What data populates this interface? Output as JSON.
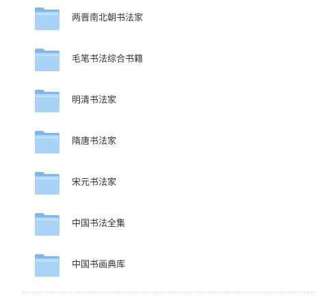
{
  "folders": [
    {
      "name": "两晋南北朝书法家",
      "icon": "folder-icon"
    },
    {
      "name": "毛笔书法综合书籍",
      "icon": "folder-icon"
    },
    {
      "name": "明清书法家",
      "icon": "folder-icon"
    },
    {
      "name": "隋唐书法家",
      "icon": "folder-icon"
    },
    {
      "name": "宋元书法家",
      "icon": "folder-icon"
    },
    {
      "name": "中国书法全集",
      "icon": "folder-icon"
    },
    {
      "name": "中国书画典库",
      "icon": "folder-icon"
    }
  ],
  "colors": {
    "folder_back": "#7fb6ec",
    "folder_front": "#a9d4f7",
    "text": "#333333",
    "divider": "#cfd6df"
  }
}
